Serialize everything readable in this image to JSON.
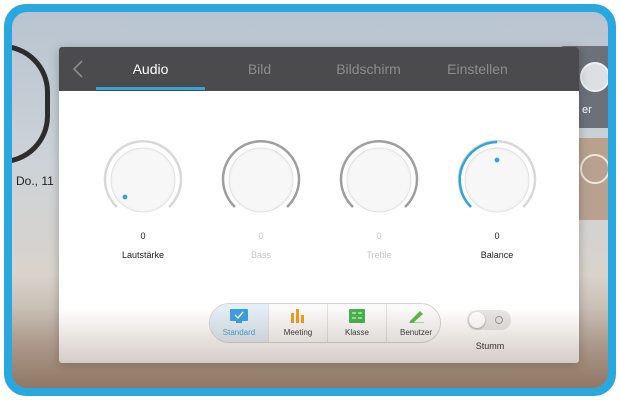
{
  "background": {
    "date_text": "Do., 11",
    "widget_label": "er"
  },
  "dialog": {
    "tabs": [
      {
        "label": "Audio",
        "active": true
      },
      {
        "label": "Bild",
        "active": false
      },
      {
        "label": "Bildschirm",
        "active": false
      },
      {
        "label": "Einstellen",
        "active": false
      }
    ],
    "knobs": [
      {
        "label": "Lautstärke",
        "value": "0",
        "enabled": true
      },
      {
        "label": "Bass",
        "value": "0",
        "enabled": false
      },
      {
        "label": "Treble",
        "value": "0",
        "enabled": false
      },
      {
        "label": "Balance",
        "value": "0",
        "enabled": true
      }
    ],
    "modes": [
      {
        "label": "Standard",
        "icon": "check-screen-icon",
        "selected": true
      },
      {
        "label": "Meeting",
        "icon": "bar-chart-icon",
        "selected": false
      },
      {
        "label": "Klasse",
        "icon": "classroom-board-icon",
        "selected": false
      },
      {
        "label": "Benutzer",
        "icon": "edit-pen-icon",
        "selected": false
      }
    ],
    "mute": {
      "label": "Stumm",
      "on": false
    }
  },
  "colors": {
    "accent": "#2fa6d6",
    "tabbar": "#4b4b4d",
    "frame": "#29a7df"
  }
}
